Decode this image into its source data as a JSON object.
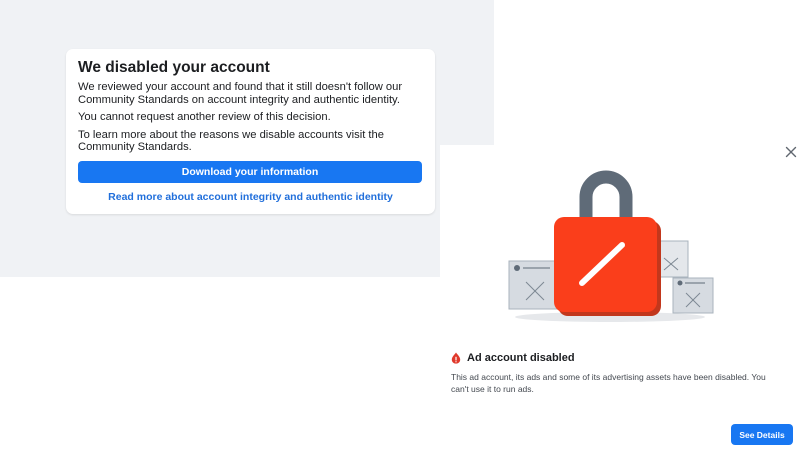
{
  "card": {
    "title": "We disabled your account",
    "paragraph1": "We reviewed your account and found that it still doesn't follow our Community Standards on account integrity and authentic identity.",
    "paragraph2": "You cannot request another review of this decision.",
    "paragraph3": "To learn more about the reasons we disable accounts visit the Community Standards.",
    "download_button": "Download your information",
    "read_more_link": "Read more about account integrity and authentic identity"
  },
  "dialog": {
    "close_icon": "close-icon",
    "illustration_icon": "padlock-icon",
    "warning_icon": "alert-icon",
    "title": "Ad account disabled",
    "description": "This ad account, its ads and some of its advertising assets have been disabled. You can't use it to run ads.",
    "see_details_button": "See Details"
  },
  "colors": {
    "accent": "#1877f2",
    "link": "#216fdb",
    "background_gray": "#f0f2f5",
    "lock_red": "#fa3e1b",
    "lock_shackle": "#5f6b78"
  }
}
